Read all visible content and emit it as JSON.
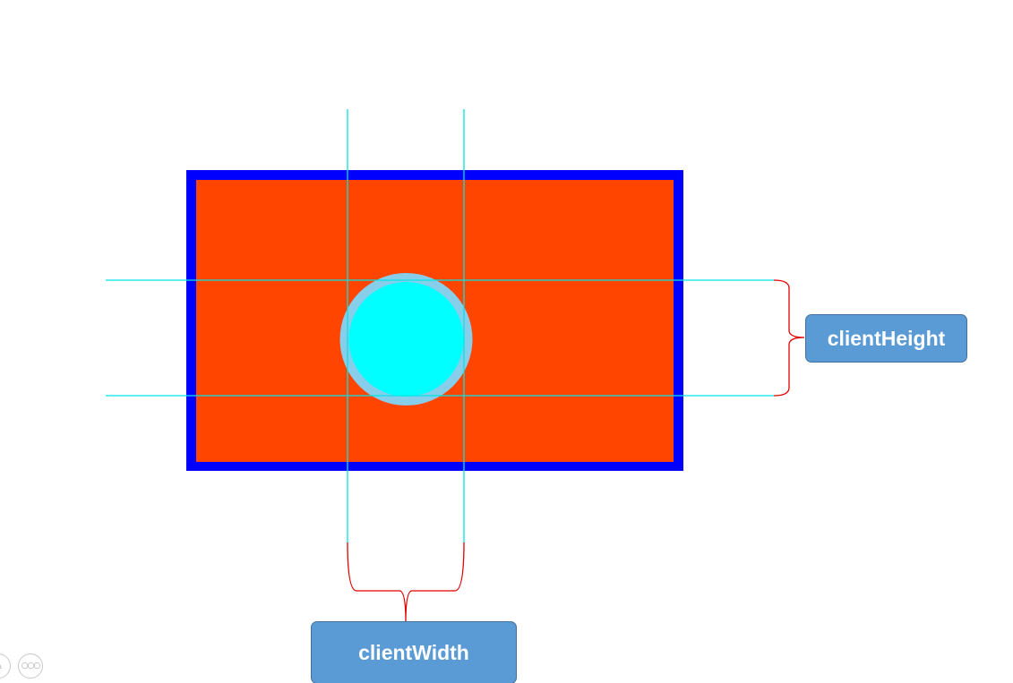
{
  "colors": {
    "outer_border": "#0000ff",
    "box_fill": "#ff4500",
    "circle_fill": "#00ffff",
    "circle_ring": "#87ceeb",
    "guide_lines": "#00e5e5",
    "brace": "#e00000",
    "label_fill": "#5b9bd5",
    "label_text": "#ffffff"
  },
  "labels": {
    "client_height": "clientHeight",
    "client_width": "clientWidth"
  },
  "toolbar": {
    "pen_icon": "pen-icon",
    "more_icon": "more-icon"
  }
}
